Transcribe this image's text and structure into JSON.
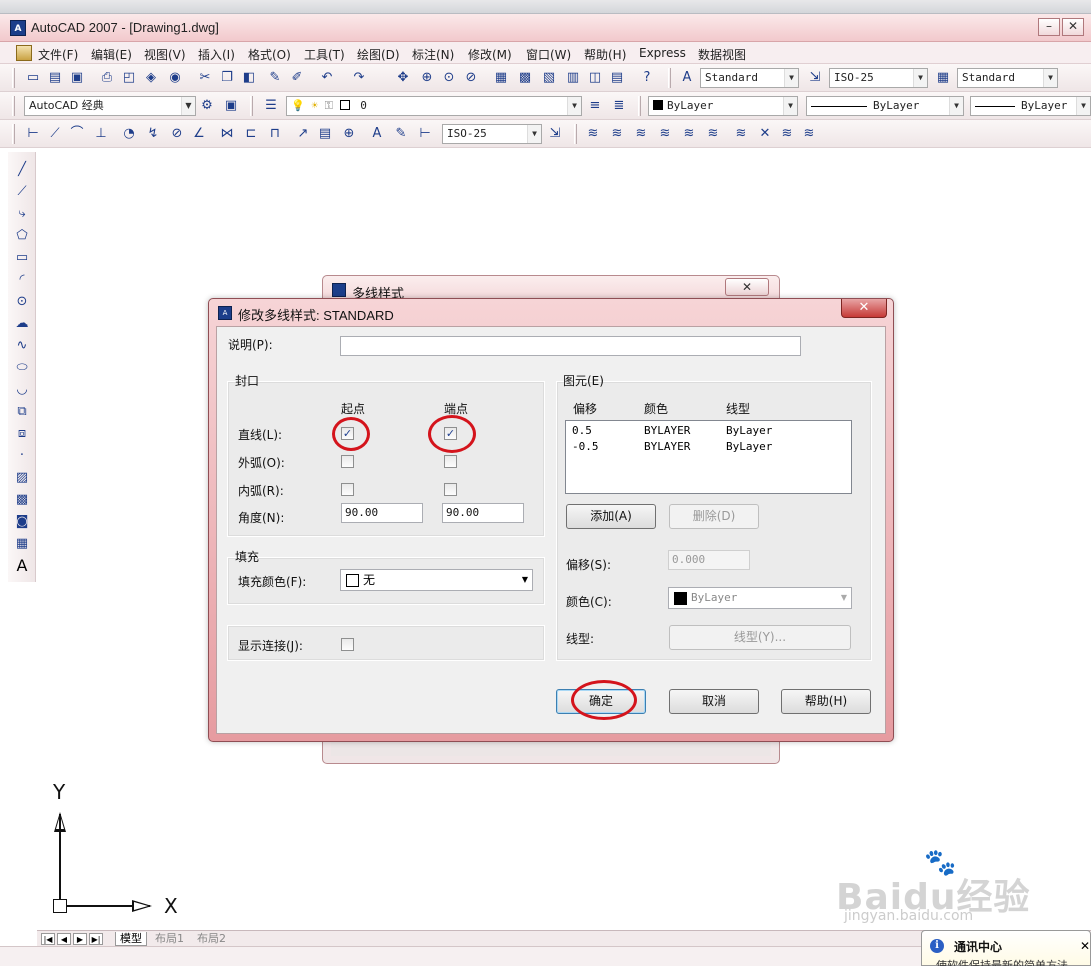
{
  "window": {
    "title": "AutoCAD 2007 - [Drawing1.dwg]",
    "app_icon_text": "A",
    "minimize": "–",
    "close": "✕"
  },
  "menu": [
    "文件(F)",
    "编辑(E)",
    "视图(V)",
    "插入(I)",
    "格式(O)",
    "工具(T)",
    "绘图(D)",
    "标注(N)",
    "修改(M)",
    "窗口(W)",
    "帮助(H)",
    "Express",
    "数据视图"
  ],
  "toolbar": {
    "text_style": "Standard",
    "dim_style": "ISO-25",
    "table_style": "Standard",
    "workspace": "AutoCAD 经典",
    "layer": "0",
    "color": "ByLayer",
    "linetype": "ByLayer",
    "lineweight": "ByLayer",
    "dim_style_2": "ISO-25"
  },
  "layout_tabs": {
    "tabs": [
      "模型",
      "布局1",
      "布局2"
    ],
    "active": "模型"
  },
  "ucs": {
    "x_label": "X",
    "y_label": "Y"
  },
  "notification": {
    "title": "通讯中心",
    "text": "使软件保持最新的简单方法",
    "close": "✕",
    "icon": "i"
  },
  "back_dialog": {
    "title": "多线样式",
    "close": "✕"
  },
  "dialog": {
    "title": "修改多线样式: STANDARD",
    "close": "✕",
    "description_label": "说明(P):",
    "description_value": "",
    "caps": {
      "group_title": "封口",
      "col_start": "起点",
      "col_end": "端点",
      "rows": [
        {
          "label": "直线(L):",
          "start_checked": true,
          "end_checked": true
        },
        {
          "label": "外弧(O):",
          "start_checked": false,
          "end_checked": false
        },
        {
          "label": "内弧(R):",
          "start_checked": false,
          "end_checked": false
        }
      ],
      "angle_label": "角度(N):",
      "angle_start": "90.00",
      "angle_end": "90.00"
    },
    "fill": {
      "group_title": "填充",
      "color_label": "填充颜色(F):",
      "color_value": "无"
    },
    "show_joints_label": "显示连接(J):",
    "show_joints_checked": false,
    "elements": {
      "group_title": "图元(E)",
      "headers": [
        "偏移",
        "颜色",
        "线型"
      ],
      "rows": [
        {
          "offset": "0.5",
          "color": "BYLAYER",
          "linetype": "ByLayer"
        },
        {
          "offset": "-0.5",
          "color": "BYLAYER",
          "linetype": "ByLayer"
        }
      ],
      "add_label": "添加(A)",
      "delete_label": "删除(D)",
      "offset_label": "偏移(S):",
      "offset_value": "0.000",
      "color_label": "颜色(C):",
      "color_value": "ByLayer",
      "linetype_label": "线型:",
      "linetype_button": "线型(Y)..."
    },
    "ok_label": "确定",
    "cancel_label": "取消",
    "help_label": "帮助(H)",
    "check_mark": "✓"
  },
  "watermark": {
    "main": "Baidu经验",
    "sub": "jingyan.baidu.com"
  },
  "colors": {
    "highlight_circle": "#d4141c",
    "titlebar": "#f2c9cc",
    "dialog_frame": "#e69ba0"
  }
}
